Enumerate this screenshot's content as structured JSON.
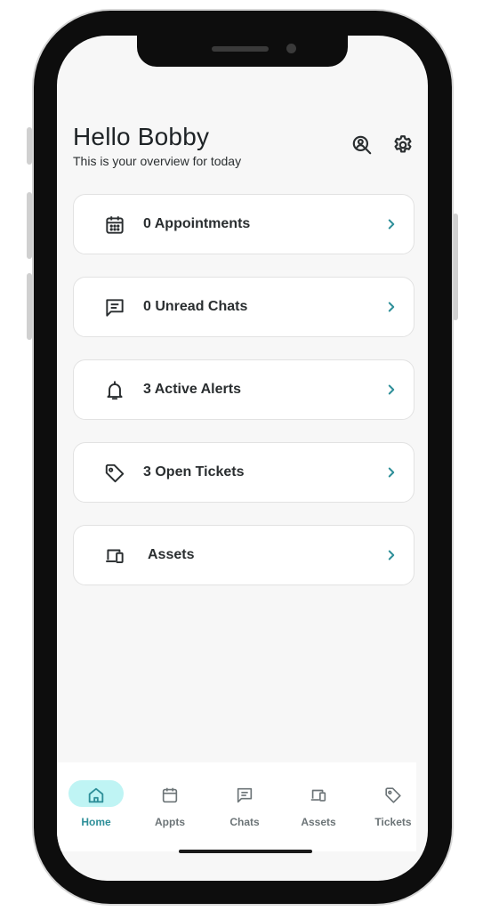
{
  "header": {
    "greeting": "Hello Bobby",
    "subtitle": "This is your overview for today",
    "icons": [
      "search-user-icon",
      "gear-icon"
    ]
  },
  "cards": [
    {
      "label": "0 Appointments",
      "icon": "calendar-icon"
    },
    {
      "label": "0 Unread Chats",
      "icon": "chat-icon"
    },
    {
      "label": "3 Active Alerts",
      "icon": "bell-icon"
    },
    {
      "label": "3 Open Tickets",
      "icon": "tag-icon"
    },
    {
      "label": "Assets",
      "icon": "devices-icon"
    }
  ],
  "tabbar": {
    "active": "Home",
    "tabs": [
      {
        "label": "Home",
        "icon": "home-icon"
      },
      {
        "label": "Appts",
        "icon": "calendar-icon"
      },
      {
        "label": "Chats",
        "icon": "chat-icon"
      },
      {
        "label": "Assets",
        "icon": "devices-icon"
      },
      {
        "label": "Tickets",
        "icon": "tag-icon"
      }
    ]
  },
  "colors": {
    "accent": "#2e8f99",
    "active_tab_bg": "#bff4f4",
    "text": "#2a2e30"
  }
}
